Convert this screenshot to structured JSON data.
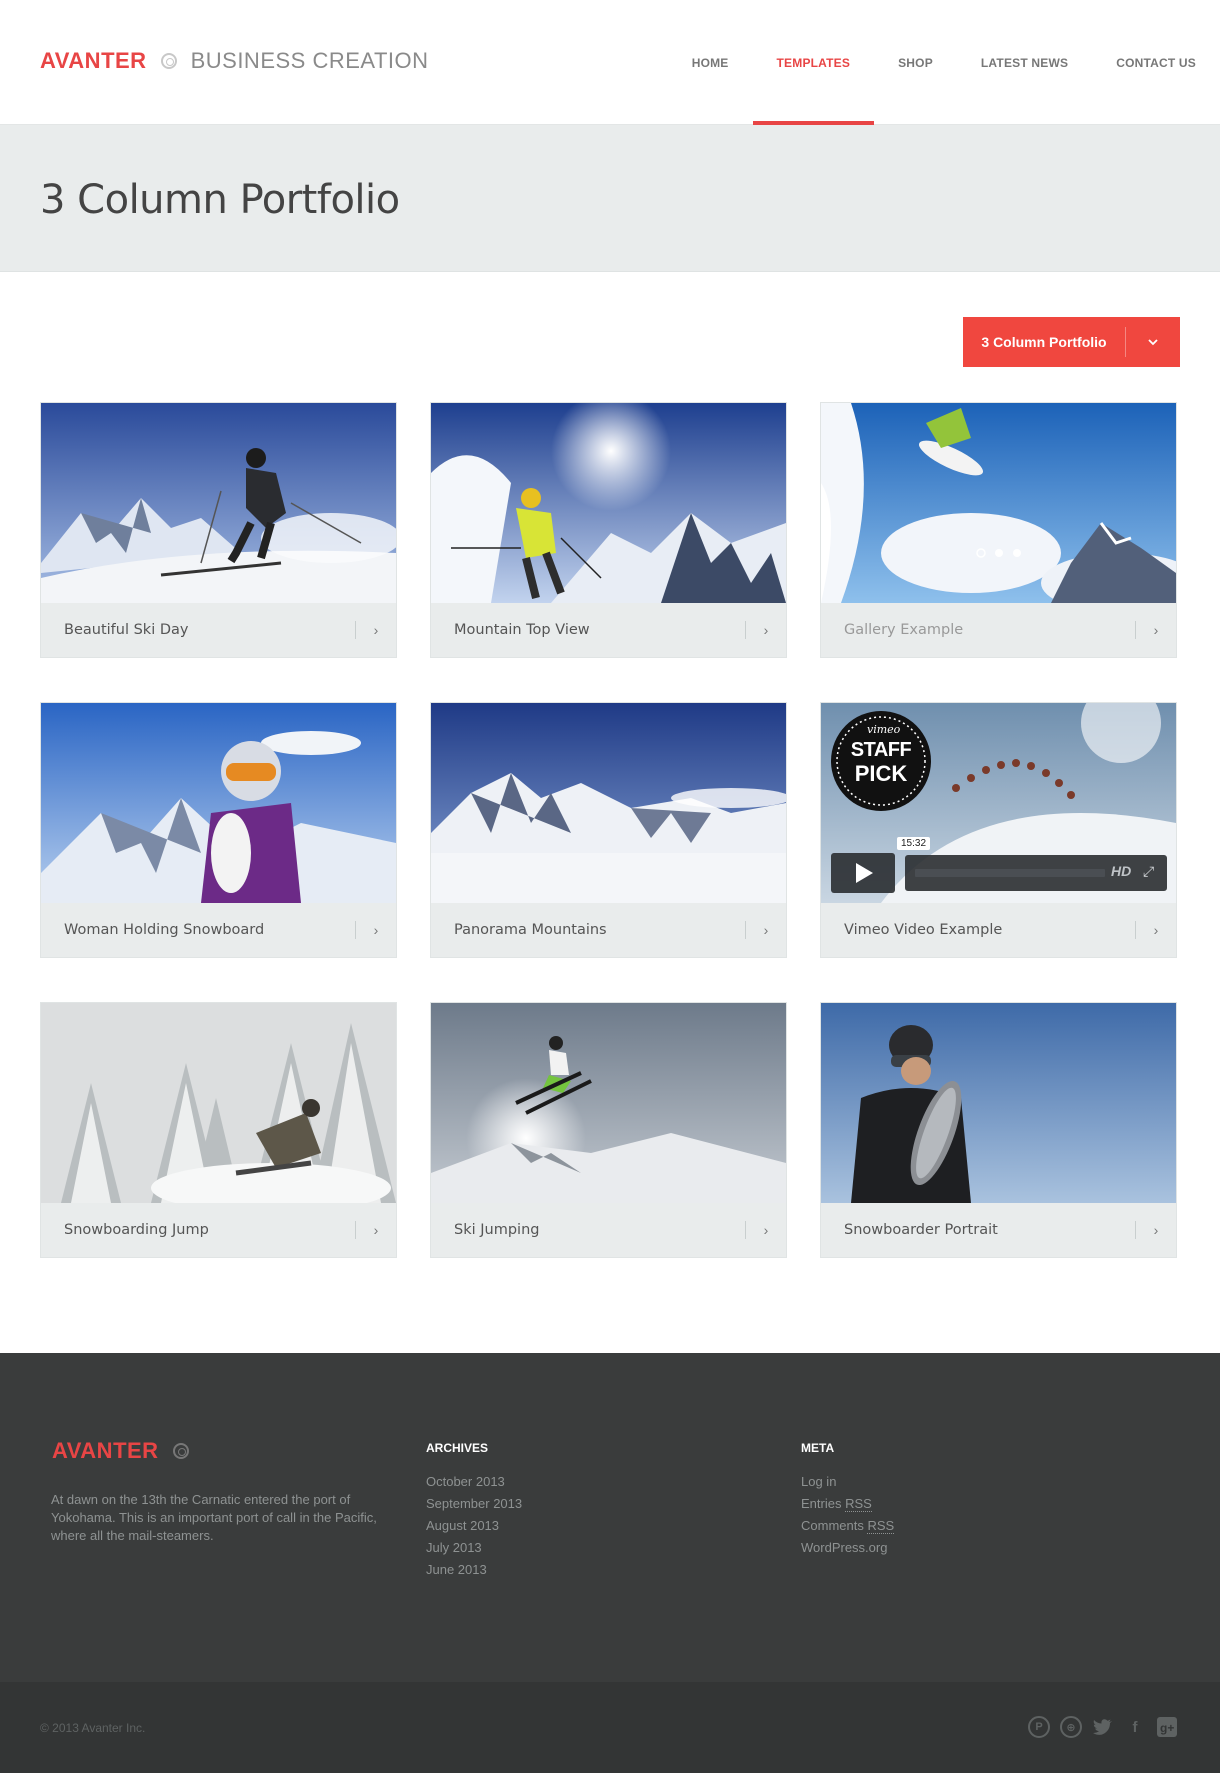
{
  "brand": {
    "name": "AVANTER",
    "tagline": "BUSINESS CREATION",
    "accent": "#e84545"
  },
  "nav": [
    {
      "label": "HOME",
      "active": false
    },
    {
      "label": "TEMPLATES",
      "active": true
    },
    {
      "label": "SHOP",
      "active": false
    },
    {
      "label": "LATEST NEWS",
      "active": false
    },
    {
      "label": "CONTACT US",
      "active": false
    }
  ],
  "page": {
    "title": "3 Column Portfolio"
  },
  "filter": {
    "label": "3 Column Portfolio",
    "icon": "chevron-down-icon"
  },
  "portfolio": [
    {
      "title": "Beautiful Ski Day",
      "arrow": "›"
    },
    {
      "title": "Mountain Top View",
      "arrow": "›"
    },
    {
      "title": "Gallery Example",
      "arrow": "›"
    },
    {
      "title": "Woman Holding Snowboard",
      "arrow": "›"
    },
    {
      "title": "Panorama Mountains",
      "arrow": "›"
    },
    {
      "title": "Vimeo Video Example",
      "arrow": "›"
    },
    {
      "title": "Snowboarding Jump",
      "arrow": "›"
    },
    {
      "title": "Ski Jumping",
      "arrow": "›"
    },
    {
      "title": "Snowboarder Portrait",
      "arrow": "›"
    }
  ],
  "video": {
    "badge_top": "vimeo",
    "badge_line1": "STAFF",
    "badge_line2": "PICK",
    "duration": "15:32",
    "hd": "HD"
  },
  "footer": {
    "brand": "AVANTER",
    "about": "At dawn on the 13th the Carnatic entered the port of Yokohama. This is an important port of call in the Pacific, where all the mail-steamers.",
    "archives": {
      "heading": "ARCHIVES",
      "items": [
        "October 2013",
        "September 2013",
        "August 2013",
        "July 2013",
        "June 2013"
      ]
    },
    "meta": {
      "heading": "META",
      "login": "Log in",
      "entries": "Entries",
      "comments": "Comments",
      "rss": "RSS",
      "wordpress": "WordPress.org"
    },
    "copyright": "© 2013 Avanter Inc.",
    "socials": [
      "pinterest-icon",
      "dribbble-icon",
      "twitter-icon",
      "facebook-icon",
      "google-plus-icon"
    ]
  }
}
